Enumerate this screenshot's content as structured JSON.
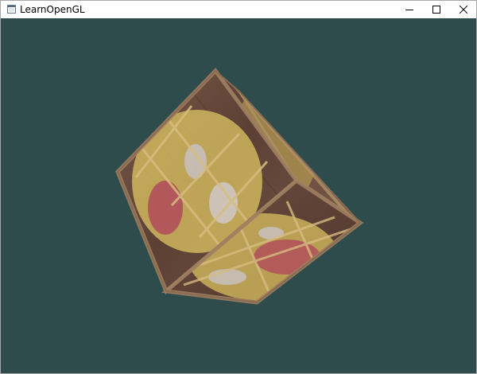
{
  "window": {
    "title": "LearnOpenGL",
    "app_icon": "window-app-icon",
    "controls": {
      "minimize_icon": "minimize-icon",
      "maximize_icon": "maximize-icon",
      "close_icon": "close-icon"
    }
  },
  "viewport": {
    "clear_color": "#2f4c4c",
    "content": "textured-rotating-cube"
  },
  "colors": {
    "crate_wood": "#6a4d40",
    "crate_frame": "#9a7a5e",
    "face_yellow": "#d8c060",
    "face_pink": "#b04a5a"
  }
}
